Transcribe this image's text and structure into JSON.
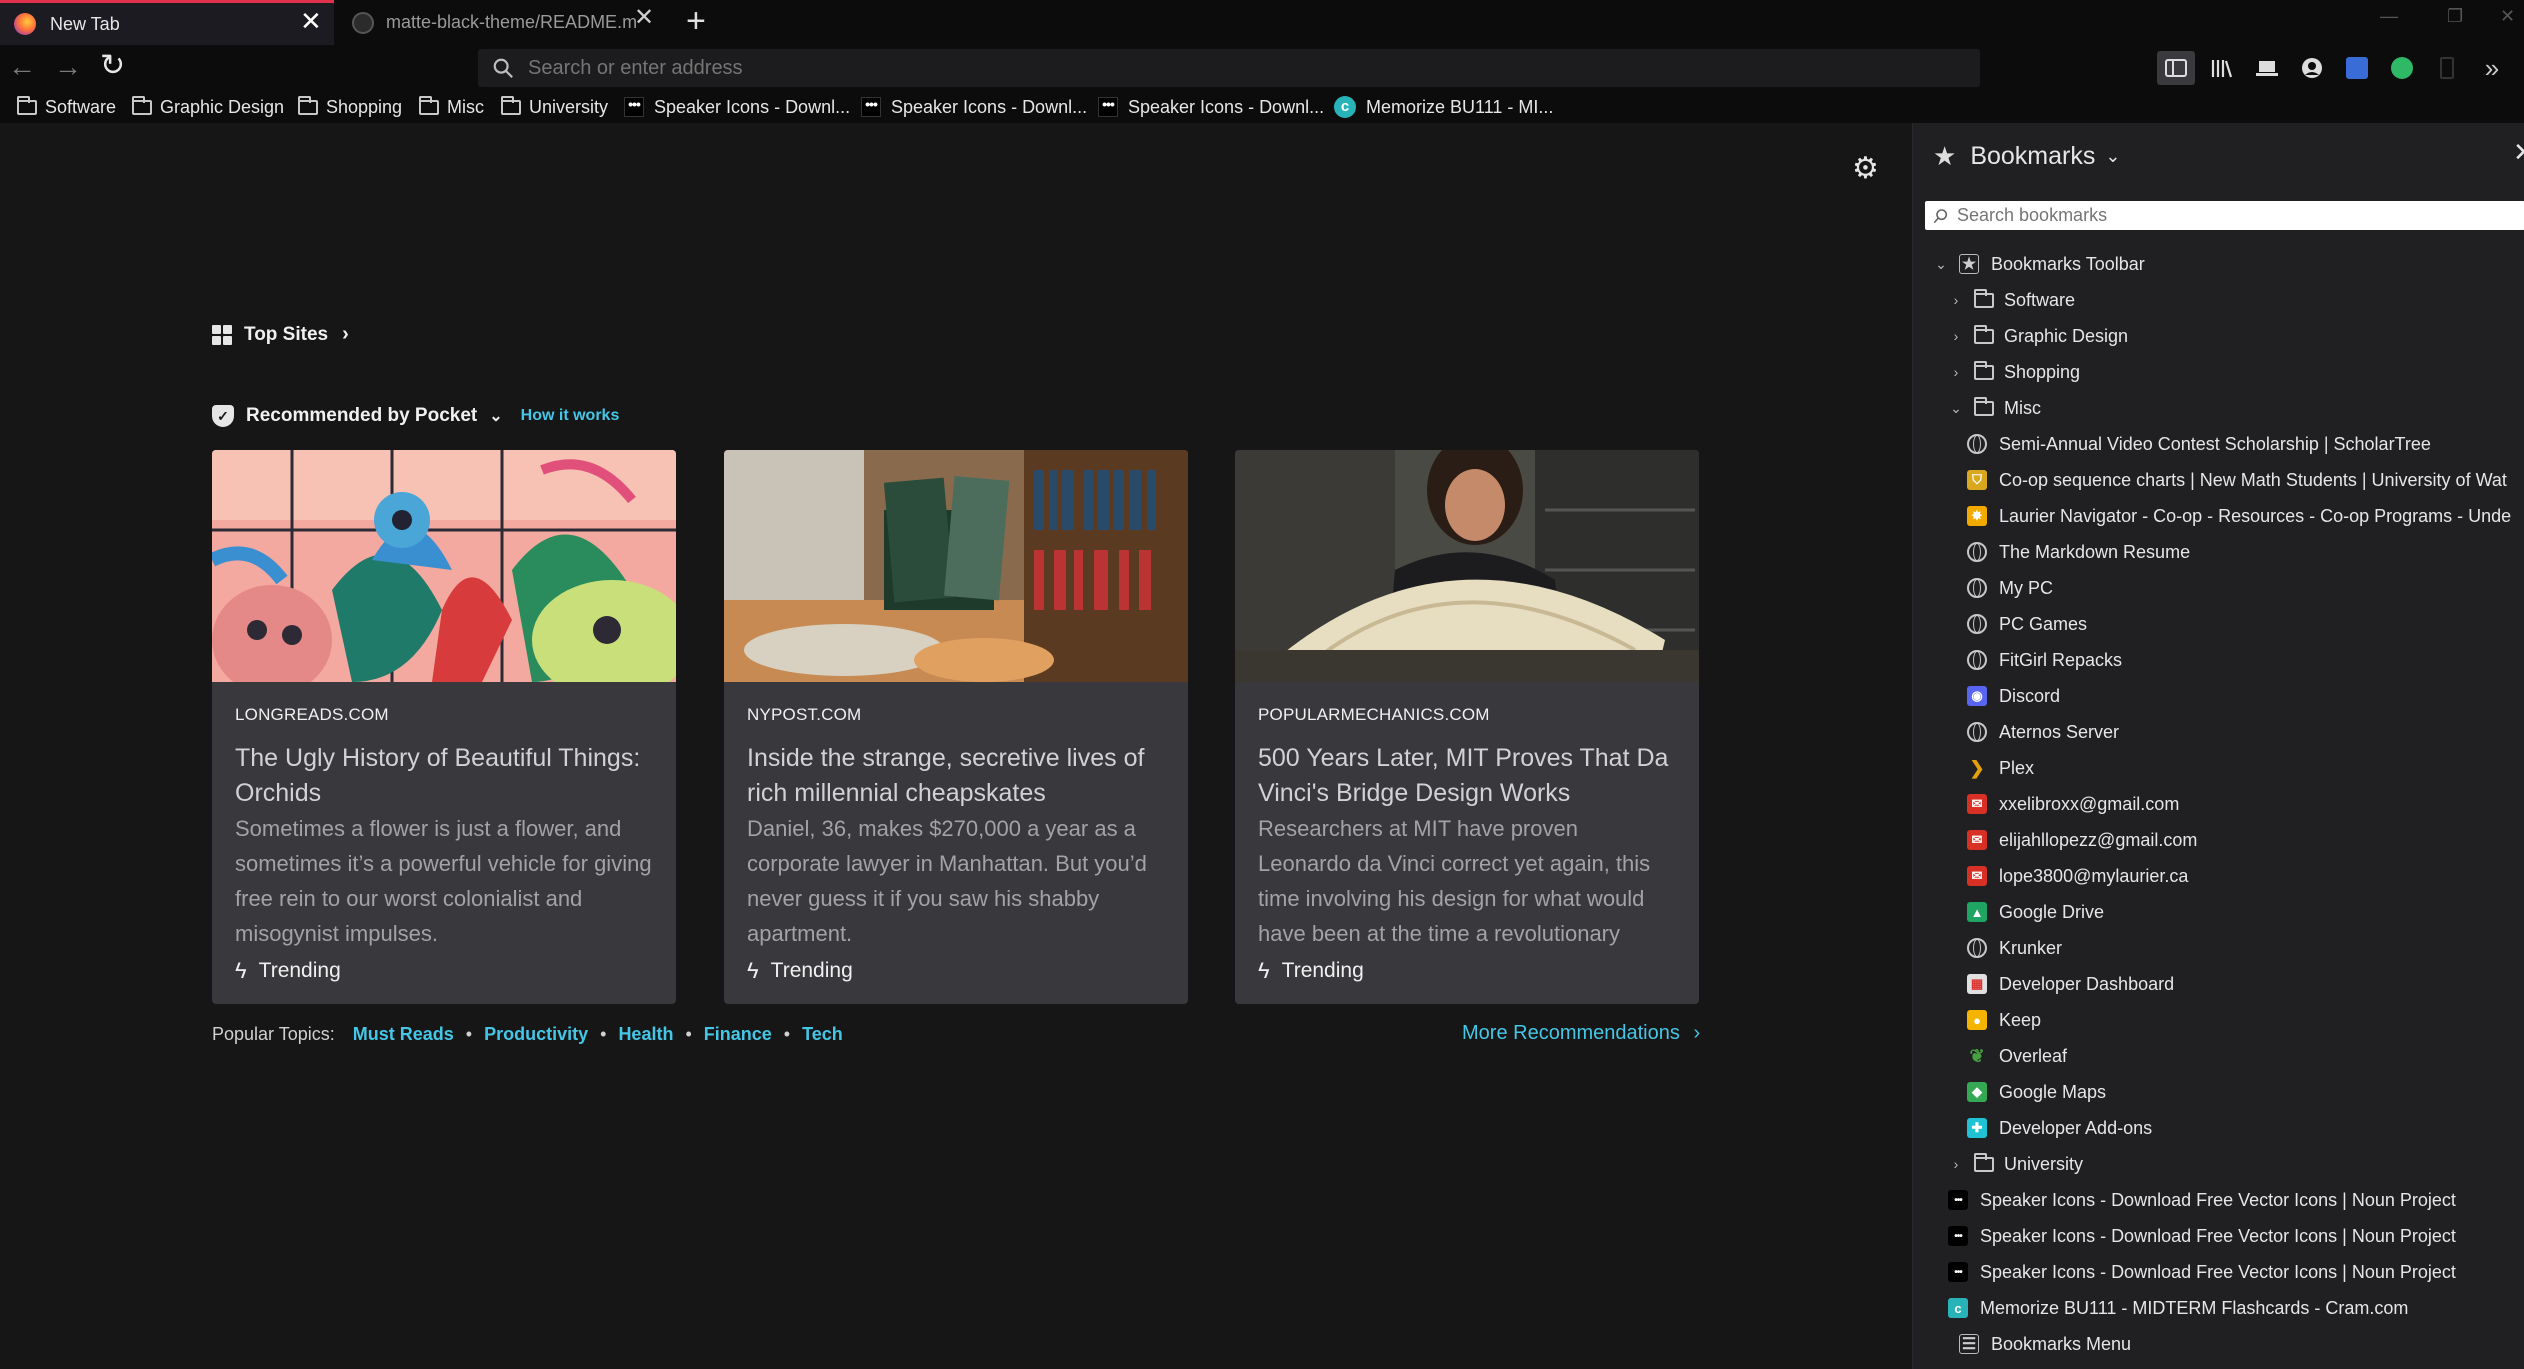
{
  "tabs": [
    {
      "title": "New Tab",
      "active": true
    },
    {
      "title": "matte-black-theme/README.m",
      "active": false
    }
  ],
  "url_bar": {
    "placeholder": "Search or enter address"
  },
  "bookmarks_bar": {
    "items": [
      {
        "label": "Software",
        "icon": "folder-icon"
      },
      {
        "label": "Graphic Design",
        "icon": "folder-icon"
      },
      {
        "label": "Shopping",
        "icon": "folder-icon"
      },
      {
        "label": "Misc",
        "icon": "folder-icon"
      },
      {
        "label": "University",
        "icon": "folder-icon"
      },
      {
        "label": "Speaker Icons - Downl...",
        "icon": "noun-project-icon"
      },
      {
        "label": "Speaker Icons - Downl...",
        "icon": "noun-project-icon"
      },
      {
        "label": "Speaker Icons - Downl...",
        "icon": "noun-project-icon"
      },
      {
        "label": "Memorize BU111 - MI...",
        "icon": "cram-icon"
      }
    ]
  },
  "newtab": {
    "top_sites_label": "Top Sites",
    "pocket_label": "Recommended by Pocket",
    "how_it_works": "How it works",
    "cards": [
      {
        "source": "LONGREADS.COM",
        "title": "The Ugly History of Beautiful Things: Orchids",
        "excerpt": "Sometimes a flower is just a flower, and sometimes it’s a powerful vehicle for giving free rein to our worst colonialist and misogynist impulses.",
        "context": "Trending"
      },
      {
        "source": "NYPOST.COM",
        "title": "Inside the strange, secretive lives of rich millennial cheapskates",
        "excerpt": "Daniel, 36, makes $270,000 a year as a corporate lawyer in Manhattan. But you’d never guess it if you saw his shabby apartment.",
        "context": "Trending"
      },
      {
        "source": "POPULARMECHANICS.COM",
        "title": "500 Years Later, MIT Proves That Da Vinci's Bridge Design Works",
        "excerpt": "Researchers at MIT have proven Leonardo da Vinci correct yet again, this time involving his design for what would have been at the time a revolutionary",
        "context": "Trending"
      }
    ],
    "popular_topics_label": "Popular Topics:",
    "topics": [
      "Must Reads",
      "Productivity",
      "Health",
      "Finance",
      "Tech"
    ],
    "more_recommendations": "More Recommendations"
  },
  "sidebar": {
    "title": "Bookmarks",
    "search_placeholder": "Search bookmarks",
    "tree": [
      {
        "label": "Bookmarks Toolbar",
        "level": 0,
        "twisty": "open",
        "icon": "star-folder-icon"
      },
      {
        "label": "Software",
        "level": 1,
        "twisty": "closed",
        "icon": "folder-icon"
      },
      {
        "label": "Graphic Design",
        "level": 1,
        "twisty": "closed",
        "icon": "folder-icon"
      },
      {
        "label": "Shopping",
        "level": 1,
        "twisty": "closed",
        "icon": "folder-icon"
      },
      {
        "label": "Misc",
        "level": 1,
        "twisty": "open",
        "icon": "folder-icon"
      },
      {
        "label": "Semi-Annual Video Contest Scholarship | ScholarTree",
        "level": 2,
        "icon": "globe-icon"
      },
      {
        "label": "Co-op sequence charts | New Math Students | University of Wat",
        "level": 2,
        "icon": "waterloo-shield-icon"
      },
      {
        "label": "Laurier Navigator - Co-op - Resources - Co-op Programs - Unde",
        "level": 2,
        "icon": "laurier-icon"
      },
      {
        "label": "The Markdown Resume",
        "level": 2,
        "icon": "globe-icon"
      },
      {
        "label": "My PC",
        "level": 2,
        "icon": "globe-icon"
      },
      {
        "label": "PC Games",
        "level": 2,
        "icon": "globe-icon"
      },
      {
        "label": "FitGirl Repacks",
        "level": 2,
        "icon": "globe-icon"
      },
      {
        "label": "Discord",
        "level": 2,
        "icon": "discord-icon"
      },
      {
        "label": "Aternos Server",
        "level": 2,
        "icon": "globe-icon"
      },
      {
        "label": "Plex",
        "level": 2,
        "icon": "plex-icon"
      },
      {
        "label": "xxelibroxx@gmail.com",
        "level": 2,
        "icon": "gmail-icon"
      },
      {
        "label": "elijahllopezz@gmail.com",
        "level": 2,
        "icon": "gmail-icon"
      },
      {
        "label": "lope3800@mylaurier.ca",
        "level": 2,
        "icon": "gmail-icon"
      },
      {
        "label": "Google Drive",
        "level": 2,
        "icon": "google-drive-icon"
      },
      {
        "label": "Krunker",
        "level": 2,
        "icon": "globe-icon"
      },
      {
        "label": "Developer Dashboard",
        "level": 2,
        "icon": "developer-dashboard-icon"
      },
      {
        "label": "Keep",
        "level": 2,
        "icon": "google-keep-icon"
      },
      {
        "label": "Overleaf",
        "level": 2,
        "icon": "overleaf-icon"
      },
      {
        "label": "Google Maps",
        "level": 2,
        "icon": "google-maps-icon"
      },
      {
        "label": "Developer Add-ons",
        "level": 2,
        "icon": "developer-addons-icon"
      },
      {
        "label": "University",
        "level": 1,
        "twisty": "closed",
        "icon": "folder-icon"
      },
      {
        "label": "Speaker Icons - Download Free Vector Icons | Noun Project",
        "level": 1,
        "icon": "noun-project-icon"
      },
      {
        "label": "Speaker Icons - Download Free Vector Icons | Noun Project",
        "level": 1,
        "icon": "noun-project-icon"
      },
      {
        "label": "Speaker Icons - Download Free Vector Icons | Noun Project",
        "level": 1,
        "icon": "noun-project-icon"
      },
      {
        "label": "Memorize BU111 - MIDTERM Flashcards - Cram.com",
        "level": 1,
        "icon": "cram-icon"
      },
      {
        "label": "Bookmarks Menu",
        "level": 0,
        "icon": "bookmarks-menu-icon"
      }
    ]
  },
  "colors": {
    "accent_link": "#45c6e6",
    "tab_indicator": "#e0304b",
    "card_bg": "#38383d",
    "page_bg": "#161617",
    "sidebar_bg": "#202023"
  }
}
